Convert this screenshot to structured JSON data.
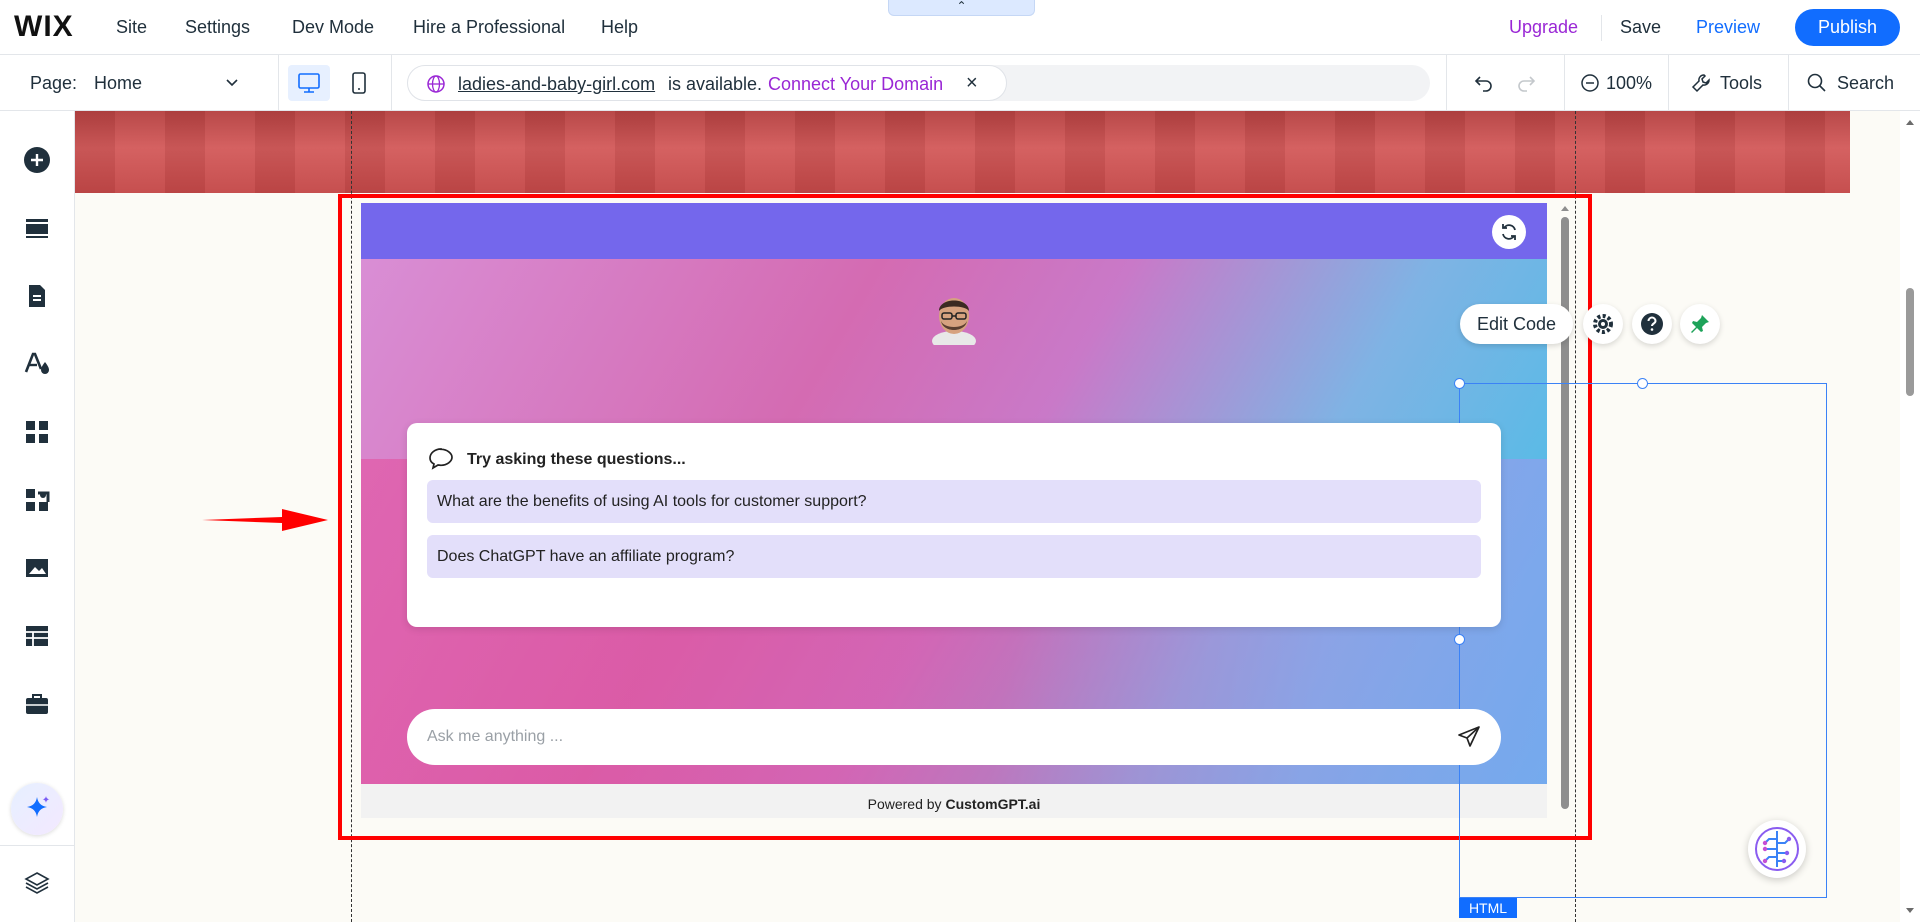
{
  "topbar": {
    "logo": "WIX",
    "menu": [
      "Site",
      "Settings",
      "Dev Mode",
      "Hire a Professional",
      "Help"
    ],
    "upgrade": "Upgrade",
    "save": "Save",
    "preview": "Preview",
    "publish": "Publish",
    "colors": {
      "accent": "#116dff",
      "upgrade": "#9a27d5"
    }
  },
  "secbar": {
    "page_label": "Page:",
    "page_value": "Home",
    "domain": {
      "name": "ladies-and-baby-girl.com",
      "status": "is available.",
      "connect": "Connect Your Domain",
      "close": "×"
    },
    "zoom": "100%",
    "tools": "Tools",
    "search": "Search"
  },
  "sidebar": {
    "icons": [
      "add-icon",
      "sections-icon",
      "pages-icon",
      "design-icon",
      "apps-icon",
      "add-apps-icon",
      "media-icon",
      "cms-icon",
      "business-icon",
      "ai-assistant-icon",
      "layers-icon"
    ]
  },
  "widget": {
    "card_title": "Try asking these questions...",
    "questions": [
      "What are the benefits of using AI tools for customer support?",
      "Does ChatGPT have an affiliate program?"
    ],
    "input_placeholder": "Ask me anything ...",
    "footer_prefix": "Powered by ",
    "footer_brand": "CustomGPT.ai",
    "colors": {
      "header": "#7467ec",
      "question_bg": "#e3dffa"
    }
  },
  "editor": {
    "edit_code": "Edit Code",
    "element_tag": "HTML",
    "selection_color": "#3b82f6",
    "highlight_color": "#ff0000"
  }
}
